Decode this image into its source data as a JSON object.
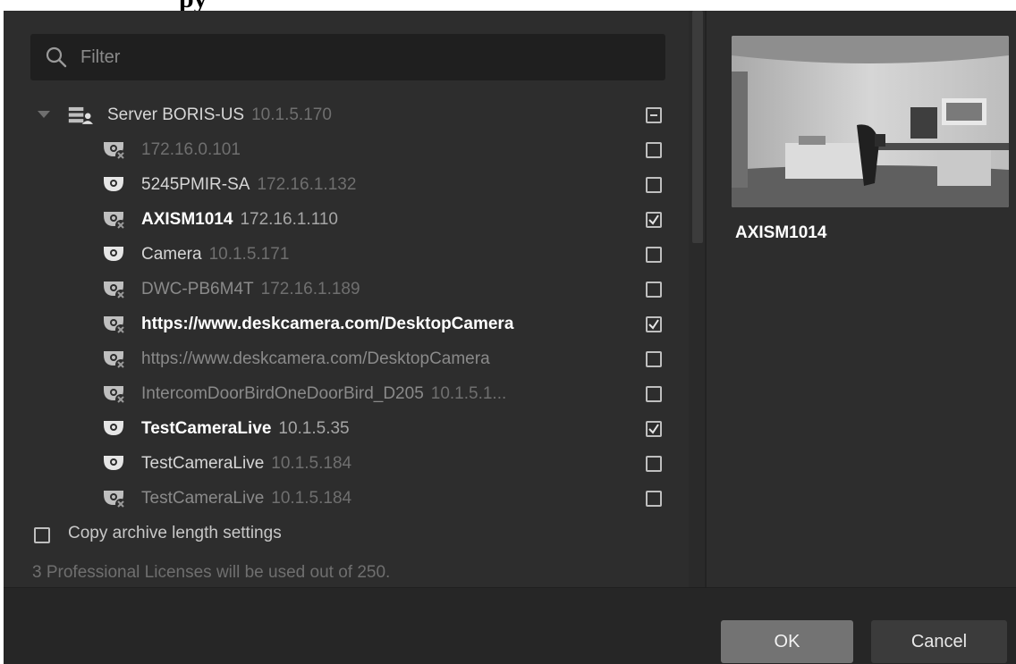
{
  "filter": {
    "placeholder": "Filter",
    "value": ""
  },
  "server": {
    "name": "Server BORIS-US",
    "ip": "10.1.5.170",
    "state": "partial"
  },
  "devices": [
    {
      "name": "",
      "ip": "172.16.0.101",
      "checked": false,
      "icon": "camera-offline-icon"
    },
    {
      "name": "5245PMIR-SA",
      "ip": "172.16.1.132",
      "checked": false,
      "icon": "camera-icon"
    },
    {
      "name": "AXISM1014",
      "ip": "172.16.1.110",
      "checked": true,
      "icon": "camera-offline-icon"
    },
    {
      "name": "Camera",
      "ip": "10.1.5.171",
      "checked": false,
      "icon": "camera-icon"
    },
    {
      "name": "DWC-PB6M4T",
      "ip": "172.16.1.189",
      "checked": false,
      "icon": "camera-offline-icon"
    },
    {
      "name": "https://www.deskcamera.com/DesktopCamera",
      "ip": "",
      "checked": true,
      "icon": "camera-offline-icon"
    },
    {
      "name": "https://www.deskcamera.com/DesktopCamera",
      "ip": "",
      "checked": false,
      "icon": "camera-offline-icon"
    },
    {
      "name": "IntercomDoorBirdOneDoorBird_D205",
      "ip": "10.1.5.1...",
      "checked": false,
      "icon": "camera-offline-icon"
    },
    {
      "name": "TestCameraLive",
      "ip": "10.1.5.35",
      "checked": true,
      "icon": "camera-icon"
    },
    {
      "name": "TestCameraLive",
      "ip": "10.1.5.184",
      "checked": false,
      "icon": "camera-icon"
    },
    {
      "name": "TestCameraLive",
      "ip": "10.1.5.184",
      "checked": false,
      "icon": "camera-offline-icon"
    }
  ],
  "copy_archive": {
    "label": "Copy archive length settings",
    "checked": false
  },
  "license_text": "3 Professional Licenses will be used out of 250.",
  "preview": {
    "camera_name": "AXISM1014"
  },
  "buttons": {
    "ok": "OK",
    "cancel": "Cancel"
  },
  "colors": {
    "dialog_bg": "#2d2d2d",
    "ok_bg": "#737373",
    "cancel_bg": "#3b3b3b"
  }
}
